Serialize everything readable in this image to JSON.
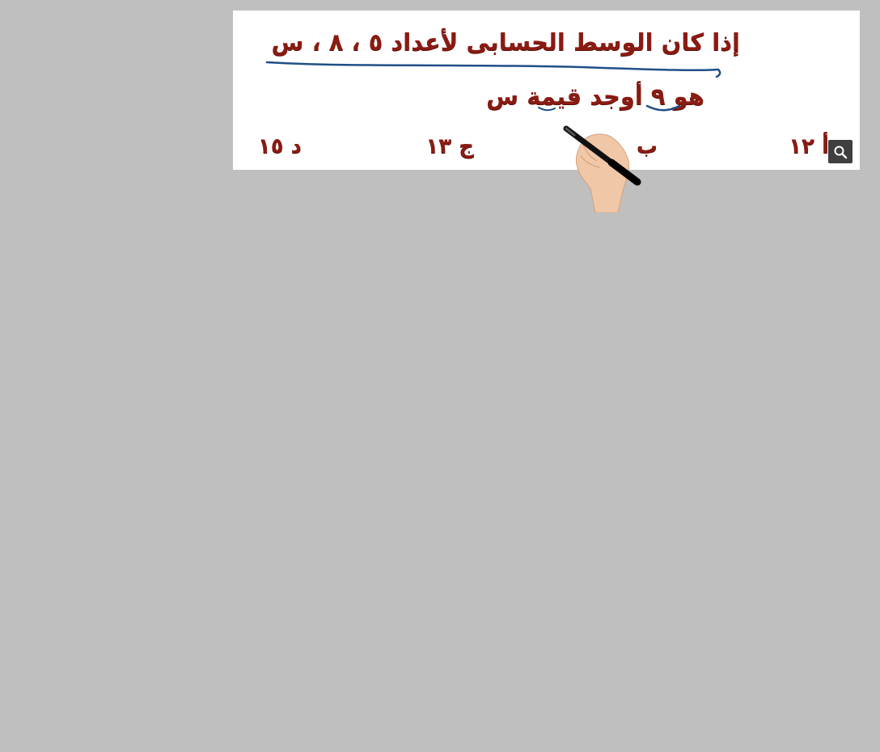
{
  "question": {
    "line1": "إذا كان الوسط الحسابى لأعداد ٥ ، ٨ ، س",
    "line2": "هو ٩ أوجد قيمة س"
  },
  "choices": {
    "a": "أ ١٢",
    "b": "ب",
    "c": "ج ١٣",
    "d": "د ١٥"
  },
  "toolbar": {
    "zoom_icon": "magnifier-icon"
  },
  "colors": {
    "background": "#bfbfbf",
    "text": "#8a1b12",
    "underline": "#1f4f86",
    "zoom_button": "#3f3f3f"
  }
}
